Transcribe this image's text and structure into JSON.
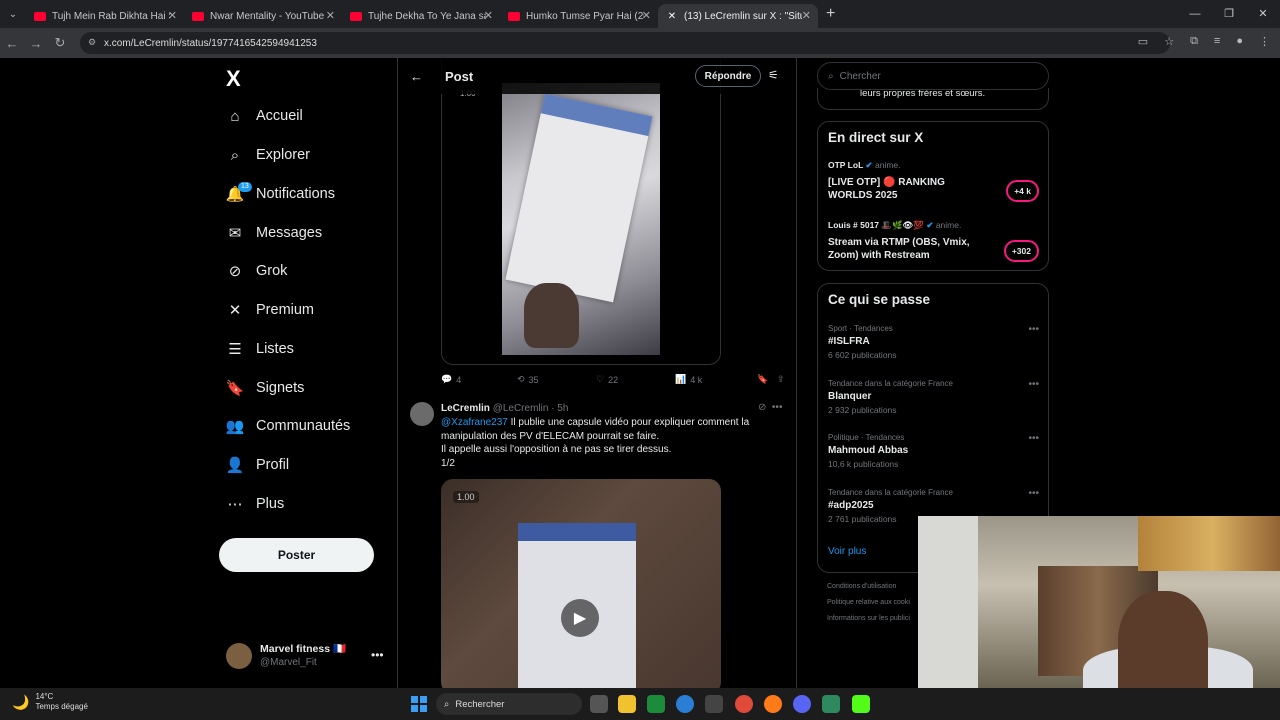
{
  "browser": {
    "tabs": [
      {
        "title": "Tujh Mein Rab Dikhta Hai Song",
        "active": false
      },
      {
        "title": "Nwar Mentality - YouTube",
        "active": false
      },
      {
        "title": "Tujhe Dekha To Ye Jana sanam",
        "active": false
      },
      {
        "title": "Humko Tumse Pyar Hai (2006)",
        "active": false
      },
      {
        "title": "(13) LeCremlin sur X : \"Situa",
        "active": true
      }
    ],
    "url": "x.com/LeCremlin/status/1977416542594941253"
  },
  "nav": {
    "logo": "X",
    "items": [
      {
        "label": "Accueil",
        "icon": "home-icon",
        "glyph": "⌂"
      },
      {
        "label": "Explorer",
        "icon": "search-icon",
        "glyph": "⌕"
      },
      {
        "label": "Notifications",
        "icon": "bell-icon",
        "glyph": "🔔",
        "badge": "13"
      },
      {
        "label": "Messages",
        "icon": "mail-icon",
        "glyph": "✉"
      },
      {
        "label": "Grok",
        "icon": "grok-icon",
        "glyph": "⊘"
      },
      {
        "label": "Premium",
        "icon": "x-premium-icon",
        "glyph": "✕"
      },
      {
        "label": "Listes",
        "icon": "list-icon",
        "glyph": "☰"
      },
      {
        "label": "Signets",
        "icon": "bookmark-icon",
        "glyph": "🔖"
      },
      {
        "label": "Communautés",
        "icon": "communities-icon",
        "glyph": "👥"
      },
      {
        "label": "Profil",
        "icon": "profile-icon",
        "glyph": "👤"
      },
      {
        "label": "Plus",
        "icon": "more-icon",
        "glyph": "⋯"
      }
    ],
    "post_button": "Poster",
    "account": {
      "name": "Marvel fitness 🇫🇷",
      "handle": "@Marvel_Fit"
    }
  },
  "main": {
    "header_title": "Post",
    "reply_button": "Répondre",
    "tweet1": {
      "video_time": "1.00",
      "replies": "4",
      "retweets": "35",
      "likes": "22",
      "views": "4 k"
    },
    "tweet2": {
      "name": "LeCremlin",
      "meta": "@LeCremlin · 5h",
      "mention": "@Xzafrane237",
      "text": " Il publie une capsule vidéo pour expliquer comment la manipulation des PV d'ELECAM pourrait se faire.",
      "text2": "Il appelle aussi l'opposition à ne pas se tirer dessus.",
      "text3": "1/2",
      "video_time": "1.00"
    }
  },
  "right": {
    "search_placeholder": "Chercher",
    "prev_tail": "leurs propres frères et sœurs.",
    "live": {
      "title": "En direct sur X",
      "items": [
        {
          "host": "OTP LoL",
          "tag": "anime.",
          "title": "[LIVE OTP] 🔴 RANKING WORLDS 2025",
          "count": "+4 k"
        },
        {
          "host": "Louis # 5017 🎩🌿👁💯",
          "tag": "anime.",
          "title": "Stream via RTMP (OBS, Vmix, Zoom) with Restream",
          "count": "+302"
        }
      ]
    },
    "trends": {
      "title": "Ce qui se passe",
      "items": [
        {
          "category": "Sport · Tendances",
          "name": "#ISLFRA",
          "count": "6 602 publications"
        },
        {
          "category": "Tendance dans la catégorie France",
          "name": "Blanquer",
          "count": "2 932 publications"
        },
        {
          "category": "Politique · Tendances",
          "name": "Mahmoud Abbas",
          "count": "10,6 k publications"
        },
        {
          "category": "Tendance dans la catégorie France",
          "name": "#adp2025",
          "count": "2 761 publications"
        }
      ],
      "more": "Voir plus"
    },
    "footer": [
      "Conditions d'utilisation",
      "Politique relative aux cooki",
      "Informations sur les publici"
    ]
  },
  "taskbar": {
    "temp": "14°C",
    "weather": "Temps dégagé",
    "search": "Rechercher"
  }
}
